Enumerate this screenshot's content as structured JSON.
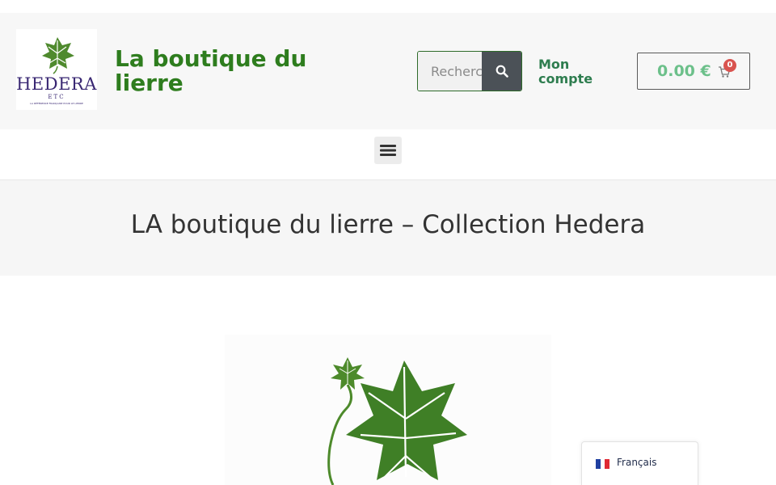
{
  "header": {
    "logo": {
      "word": "HEDERA",
      "sub": "ETC",
      "tagline": "LA RÉFÉRENCE FRANÇAISE POUR LE LIERRE"
    },
    "site_title": "La boutique du lierre",
    "search": {
      "placeholder": "Recherche",
      "icon": "search-icon"
    },
    "account_label": "Mon compte",
    "cart": {
      "total": "0.00 €",
      "count": "0",
      "icon": "cart-icon"
    }
  },
  "nav": {
    "menu_icon": "hamburger-icon"
  },
  "hero": {
    "title": "LA boutique du lierre – Collection Hedera"
  },
  "language_switcher": {
    "label": "Français",
    "flag": "fr-flag"
  },
  "colors": {
    "brand_green": "#2e7d1e",
    "account_green": "#2e7d4f",
    "cart_green": "#6cc08a",
    "logo_purple": "#3a2873",
    "badge_red": "#d9534f",
    "search_button": "#4b5157"
  }
}
